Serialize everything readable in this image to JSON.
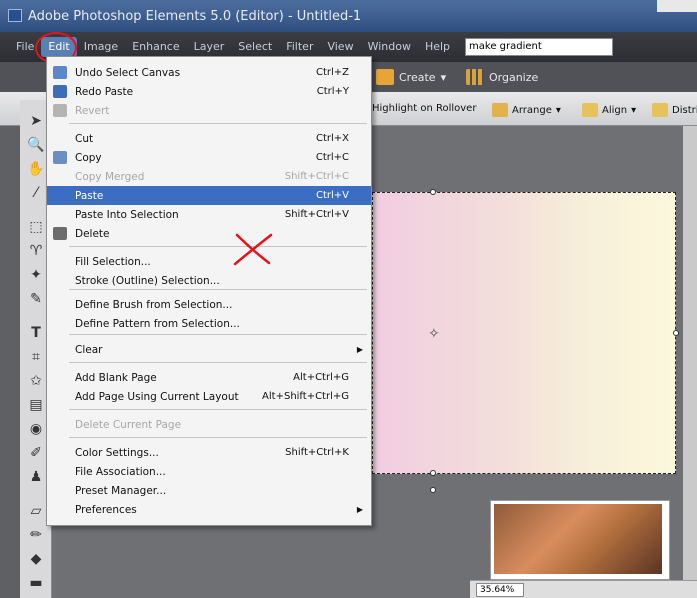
{
  "window": {
    "title": "Adobe Photoshop Elements 5.0 (Editor) - Untitled-1"
  },
  "menubar": {
    "items": [
      "File",
      "Edit",
      "Image",
      "Enhance",
      "Layer",
      "Select",
      "Filter",
      "View",
      "Window",
      "Help"
    ],
    "search_value": "make gradient"
  },
  "toolbar": {
    "create_label": "Create",
    "organize_label": "Organize"
  },
  "options_bar": {
    "highlight_label": "Highlight on Rollover",
    "arrange_label": "Arrange",
    "align_label": "Align",
    "distribute_label": "Distri"
  },
  "edit_menu": {
    "items": [
      {
        "label": "Undo Select Canvas",
        "shortcut": "Ctrl+Z",
        "state": "normal"
      },
      {
        "label": "Redo Paste",
        "shortcut": "Ctrl+Y",
        "state": "normal"
      },
      {
        "label": "Revert",
        "shortcut": "",
        "state": "disabled"
      },
      {
        "label": "Cut",
        "shortcut": "Ctrl+X",
        "state": "normal"
      },
      {
        "label": "Copy",
        "shortcut": "Ctrl+C",
        "state": "normal"
      },
      {
        "label": "Copy Merged",
        "shortcut": "Shift+Ctrl+C",
        "state": "disabled"
      },
      {
        "label": "Paste",
        "shortcut": "Ctrl+V",
        "state": "highlight"
      },
      {
        "label": "Paste Into Selection",
        "shortcut": "Shift+Ctrl+V",
        "state": "normal"
      },
      {
        "label": "Delete",
        "shortcut": "",
        "state": "normal"
      },
      {
        "label": "Fill Selection...",
        "shortcut": "",
        "state": "normal"
      },
      {
        "label": "Stroke (Outline) Selection...",
        "shortcut": "",
        "state": "normal"
      },
      {
        "label": "Define Brush from Selection...",
        "shortcut": "",
        "state": "normal"
      },
      {
        "label": "Define Pattern from Selection...",
        "shortcut": "",
        "state": "normal"
      },
      {
        "label": "Clear",
        "shortcut": "",
        "state": "normal",
        "submenu": true
      },
      {
        "label": "Add Blank Page",
        "shortcut": "Alt+Ctrl+G",
        "state": "normal"
      },
      {
        "label": "Add Page Using Current Layout",
        "shortcut": "Alt+Shift+Ctrl+G",
        "state": "normal"
      },
      {
        "label": "Delete Current Page",
        "shortcut": "",
        "state": "disabled"
      },
      {
        "label": "Color Settings...",
        "shortcut": "Shift+Ctrl+K",
        "state": "normal"
      },
      {
        "label": "File Association...",
        "shortcut": "",
        "state": "normal"
      },
      {
        "label": "Preset Manager...",
        "shortcut": "",
        "state": "normal"
      },
      {
        "label": "Preferences",
        "shortcut": "",
        "state": "normal",
        "submenu": true
      }
    ]
  },
  "status": {
    "zoom": "35.64%"
  },
  "colors": {
    "highlight": "#3b6ec2",
    "annotation_red": "#e3141b"
  }
}
